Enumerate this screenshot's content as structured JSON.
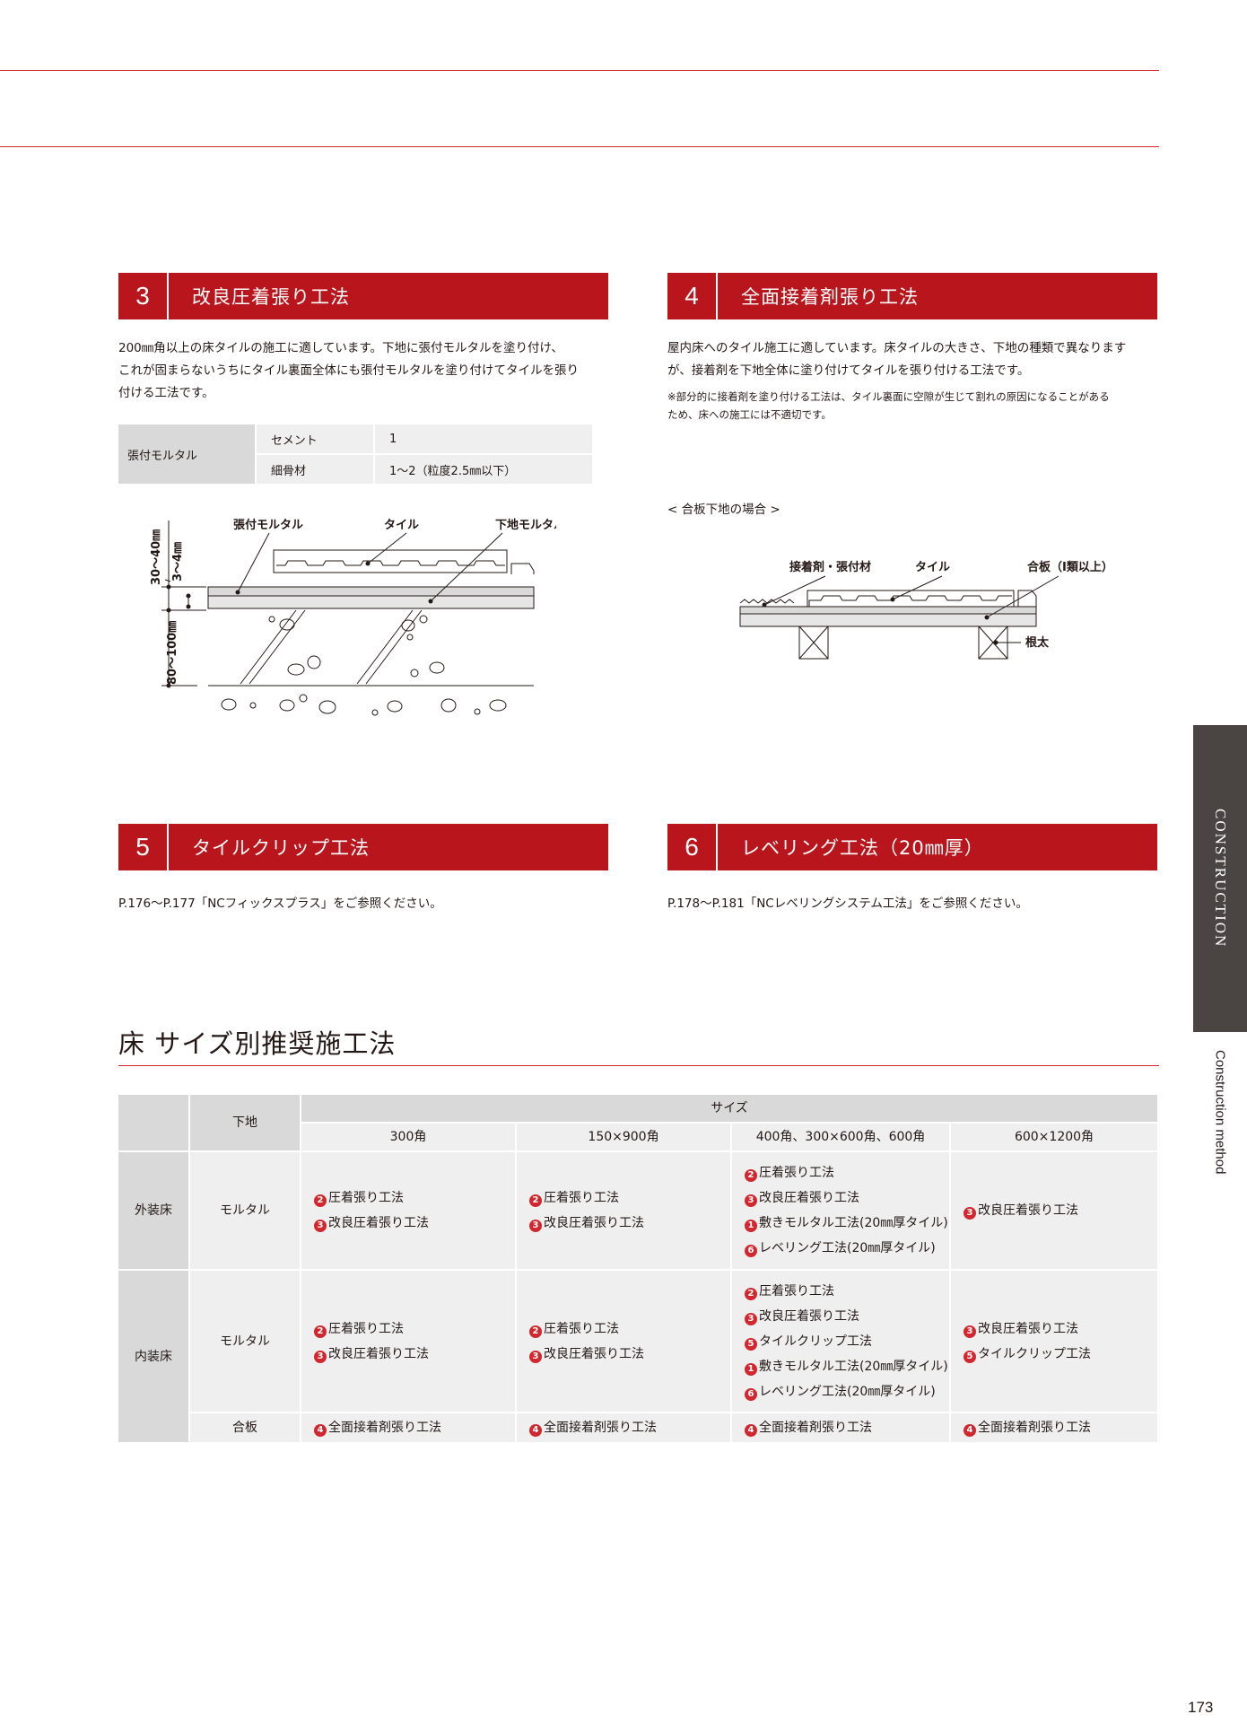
{
  "section3": {
    "number": "3",
    "title": "改良圧着張り工法",
    "lines": [
      "200㎜角以上の床タイルの施工に適しています。下地に張付モルタルを塗り付け、",
      "これが固まらないうちにタイル裏面全体にも張付モルタルを塗り付けてタイルを張り",
      "付ける工法です。"
    ],
    "mix_table": {
      "header": "張付モルタル",
      "rows": [
        {
          "key": "セメント",
          "value": "1"
        },
        {
          "key": "細骨材",
          "value": "1〜2（粒度2.5㎜以下）"
        }
      ]
    },
    "diagram": {
      "labels": [
        "張付モルタル",
        "タイル",
        "下地モルタル"
      ],
      "dims": [
        "30〜40㎜",
        "3〜4㎜",
        "80〜100㎜"
      ]
    }
  },
  "section4": {
    "number": "4",
    "title": "全面接着剤張り工法",
    "lines": [
      "屋内床へのタイル施工に適しています。床タイルの大きさ、下地の種類で異なります",
      "が、接着剤を下地全体に塗り付けてタイルを張り付ける工法です。"
    ],
    "notes": [
      "※部分的に接着剤を塗り付ける工法は、タイル裏面に空隙が生じて割れの原因になることがある",
      "ため、床への施工には不適切です。"
    ],
    "diagram": {
      "caption": "< 合板下地の場合 >",
      "labels": [
        "接着剤・張付材",
        "タイル",
        "合板（Ⅰ類以上）",
        "根太"
      ]
    }
  },
  "section5": {
    "number": "5",
    "title": "タイルクリップ工法",
    "reference": "P.176〜P.177「NCフィックスプラス」をご参照ください。"
  },
  "section6": {
    "number": "6",
    "title": "レベリング工法（20㎜厚）",
    "reference": "P.178〜P.181「NCレベリングシステム工法」をご参照ください。"
  },
  "recommend": {
    "title": "床 サイズ別推奨施工法",
    "header": {
      "base": "下地",
      "size": "サイズ",
      "sizes": [
        "300角",
        "150×900角",
        "400角、300×600角、600角",
        "600×1200角"
      ]
    },
    "exterior": {
      "category": "外装床",
      "base": "モルタル",
      "cells": [
        [
          {
            "m": "2",
            "t": "圧着張り工法"
          },
          {
            "m": "3",
            "t": "改良圧着張り工法"
          }
        ],
        [
          {
            "m": "2",
            "t": "圧着張り工法"
          },
          {
            "m": "3",
            "t": "改良圧着張り工法"
          }
        ],
        [
          {
            "m": "2",
            "t": "圧着張り工法"
          },
          {
            "m": "3",
            "t": "改良圧着張り工法"
          },
          {
            "m": "1",
            "t": "敷きモルタル工法(20㎜厚タイル)"
          },
          {
            "m": "6",
            "t": "レベリング工法(20㎜厚タイル)"
          }
        ],
        [
          {
            "m": "3",
            "t": "改良圧着張り工法"
          }
        ]
      ]
    },
    "interior": {
      "category": "内装床",
      "rows": [
        {
          "base": "モルタル",
          "cells": [
            [
              {
                "m": "2",
                "t": "圧着張り工法"
              },
              {
                "m": "3",
                "t": "改良圧着張り工法"
              }
            ],
            [
              {
                "m": "2",
                "t": "圧着張り工法"
              },
              {
                "m": "3",
                "t": "改良圧着張り工法"
              }
            ],
            [
              {
                "m": "2",
                "t": "圧着張り工法"
              },
              {
                "m": "3",
                "t": "改良圧着張り工法"
              },
              {
                "m": "5",
                "t": "タイルクリップ工法"
              },
              {
                "m": "1",
                "t": "敷きモルタル工法(20㎜厚タイル)"
              },
              {
                "m": "6",
                "t": "レベリング工法(20㎜厚タイル)"
              }
            ],
            [
              {
                "m": "3",
                "t": "改良圧着張り工法"
              },
              {
                "m": "5",
                "t": "タイルクリップ工法"
              }
            ]
          ]
        },
        {
          "base": "合板",
          "cells": [
            [
              {
                "m": "4",
                "t": "全面接着剤張り工法"
              }
            ],
            [
              {
                "m": "4",
                "t": "全面接着剤張り工法"
              }
            ],
            [
              {
                "m": "4",
                "t": "全面接着剤張り工法"
              }
            ],
            [
              {
                "m": "4",
                "t": "全面接着剤張り工法"
              }
            ]
          ]
        }
      ]
    }
  },
  "side": {
    "band_text": "CONSTRUCTION",
    "english": "Construction method"
  },
  "page_number": "173",
  "colors": {
    "accent": "#b8161c",
    "rule": "#d0282e",
    "header_gray": "#d9d9d9",
    "cell_gray": "#efefef",
    "band": "#4a4443"
  }
}
